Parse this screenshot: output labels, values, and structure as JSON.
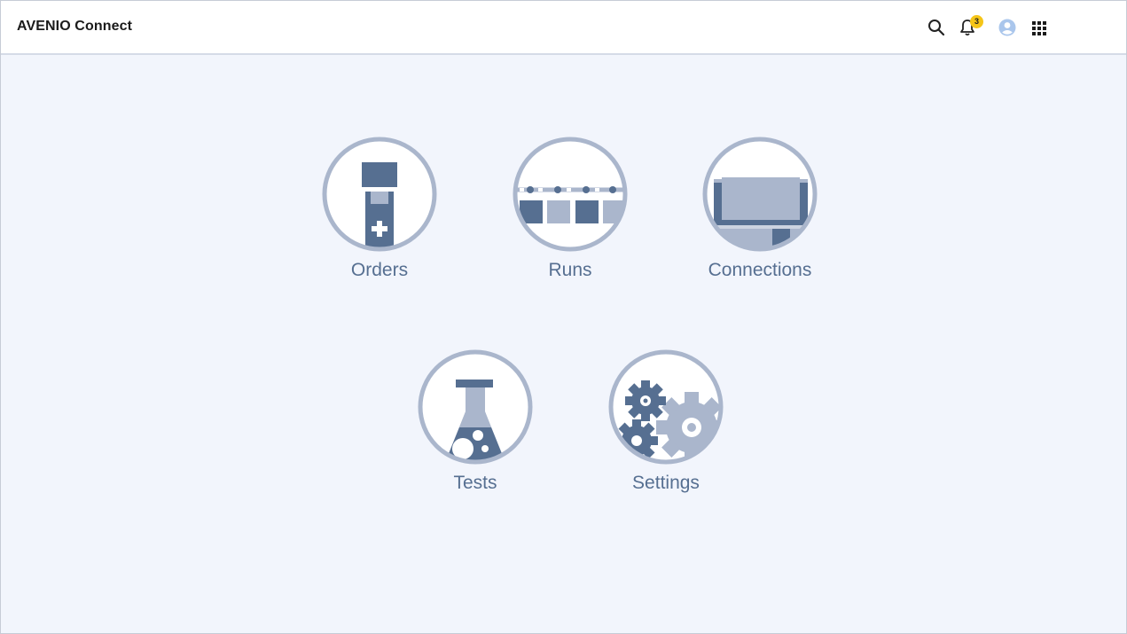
{
  "header": {
    "title": "AVENIO Connect",
    "notification_count": "3",
    "icons": [
      "search-icon",
      "bell-icon",
      "user-avatar-icon",
      "apps-grid-icon"
    ]
  },
  "tiles": [
    {
      "label": "Orders",
      "icon": "sample-tube-icon"
    },
    {
      "label": "Runs",
      "icon": "sequencer-run-icon"
    },
    {
      "label": "Connections",
      "icon": "instrument-icon"
    },
    {
      "label": "Tests",
      "icon": "flask-icon"
    },
    {
      "label": "Settings",
      "icon": "gears-icon"
    }
  ],
  "colors": {
    "background": "#f2f5fc",
    "dark_blue": "#566f91",
    "light_blue": "#aab6cc",
    "ring": "#aab6cc",
    "badge": "#f5c518"
  }
}
